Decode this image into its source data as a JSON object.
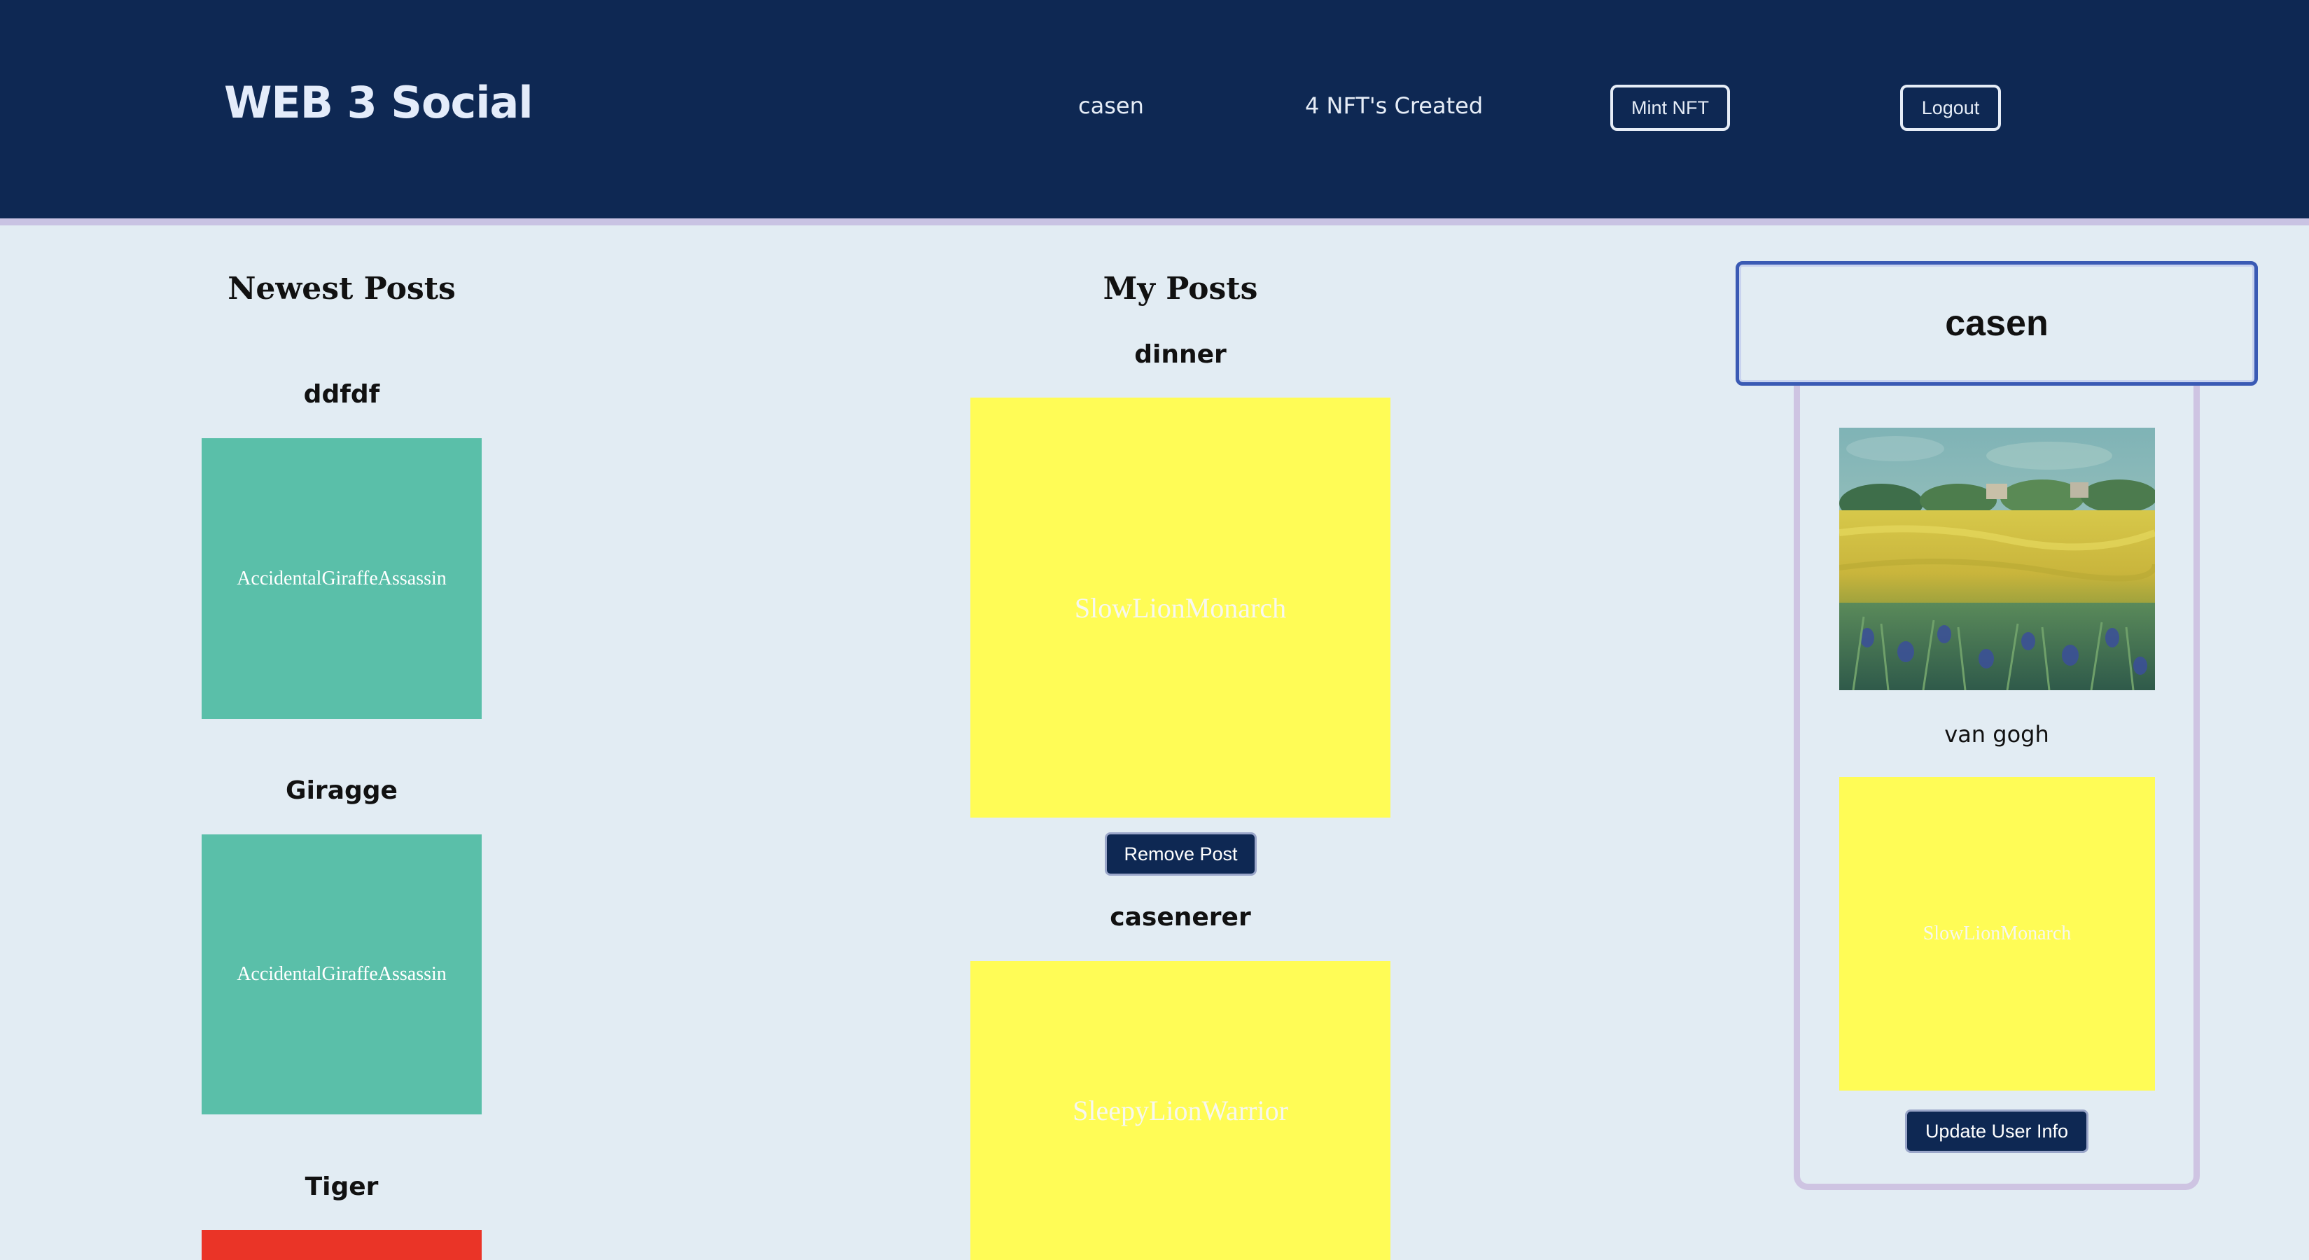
{
  "header": {
    "brand": "WEB 3 Social",
    "username": "casen",
    "nft_count": "4 NFT's Created",
    "mint_label": "Mint NFT",
    "logout_label": "Logout"
  },
  "newest": {
    "heading": "Newest Posts",
    "posts": [
      {
        "title": "ddfdf",
        "nft": "AccidentalGiraffeAssassin"
      },
      {
        "title": "Giragge",
        "nft": "AccidentalGiraffeAssassin"
      },
      {
        "title": "Tiger",
        "nft": ""
      }
    ]
  },
  "mine": {
    "heading": "My Posts",
    "remove_label": "Remove Post",
    "posts": [
      {
        "title": "dinner",
        "nft": "SlowLionMonarch"
      },
      {
        "title": "casenerer",
        "nft": "SleepyLionWarrior"
      }
    ]
  },
  "profile": {
    "name": "casen",
    "image_caption": "van gogh",
    "nft": "SlowLionMonarch",
    "update_label": "Update User Info"
  },
  "colors": {
    "header_bg": "#0e2853",
    "page_bg": "#e2ecf3",
    "green_tile": "#5abfa9",
    "yellow_tile": "#fffc56",
    "red_tile": "#ea3427"
  }
}
